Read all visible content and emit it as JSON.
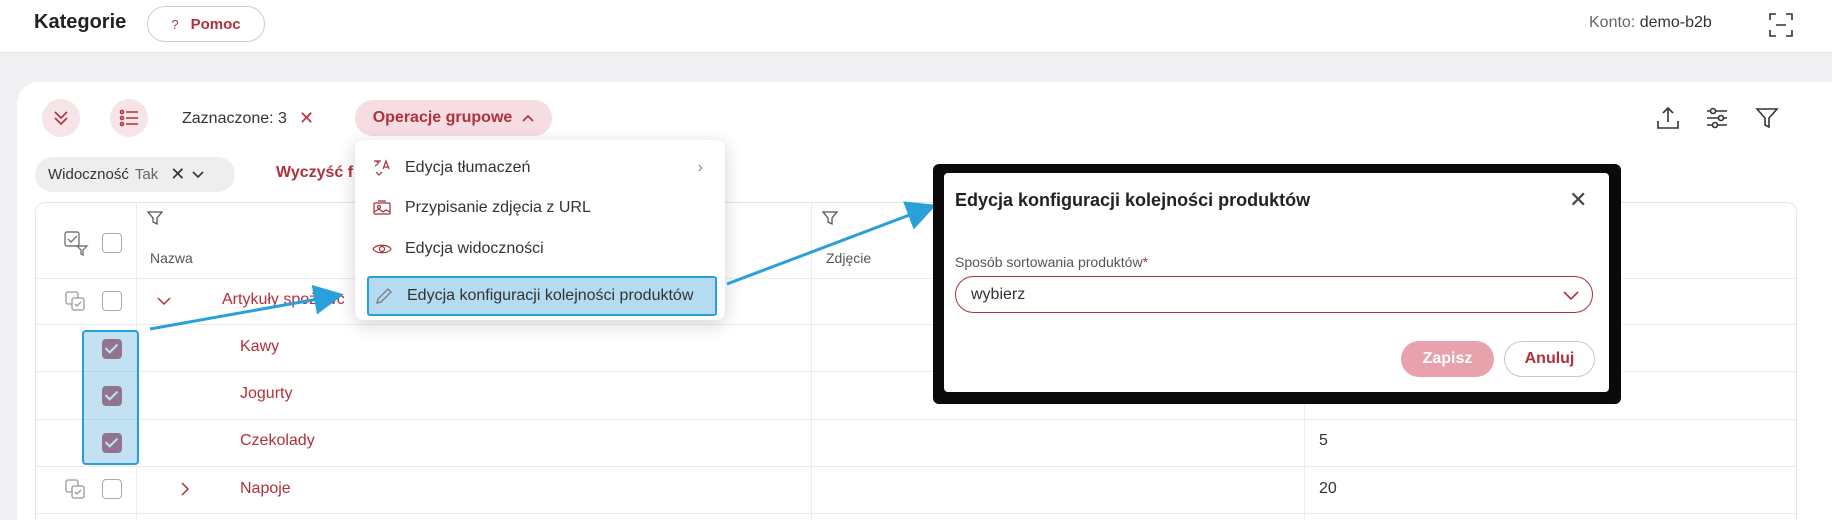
{
  "header": {
    "title": "Kategorie",
    "help_label": "Pomoc",
    "help_icon": "?",
    "account_label": "Konto:",
    "account_value": "demo-b2b"
  },
  "toolbar": {
    "selected_label": "Zaznaczone: 3",
    "clear_selected": "✕",
    "group_ops_label": "Operacje grupowe"
  },
  "filters": {
    "chip_label": "Widoczność",
    "chip_value": "Tak",
    "clear_label": "Wyczyść f"
  },
  "table": {
    "col_name": "Nazwa",
    "col_photo": "Zdjęcie",
    "rows": [
      {
        "name": "Artykuły spożywc",
        "count": ""
      },
      {
        "name": "Kawy",
        "count": ""
      },
      {
        "name": "Jogurty",
        "count": ""
      },
      {
        "name": "Czekolady",
        "count": "5"
      },
      {
        "name": "Napoje",
        "count": "20"
      }
    ]
  },
  "menu": {
    "items": [
      {
        "label": "Edycja tłumaczeń",
        "icon": "translate-icon"
      },
      {
        "label": "Przypisanie zdjęcia z URL",
        "icon": "image-icon"
      },
      {
        "label": "Edycja widoczności",
        "icon": "eye-icon"
      },
      {
        "label": "Edycja konfiguracji kolejności produktów",
        "icon": "pencil-icon"
      }
    ]
  },
  "modal": {
    "title": "Edycja konfiguracji kolejności produktów",
    "field_label": "Sposób sortowania produktów",
    "required_mark": "*",
    "select_value": "wybierz",
    "save_label": "Zapisz",
    "cancel_label": "Anuluj"
  },
  "colors": {
    "accent": "#b0303c",
    "highlight": "#2aa0db"
  }
}
